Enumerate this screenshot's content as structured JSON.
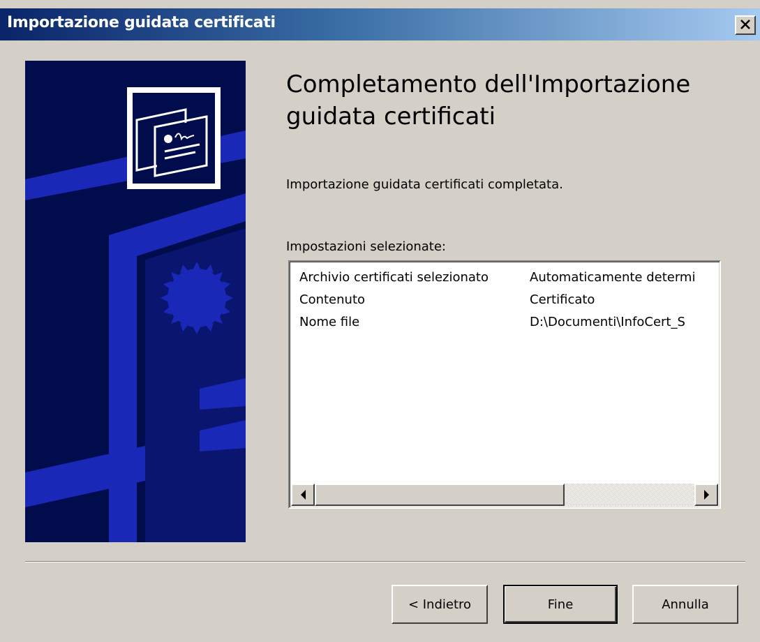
{
  "window": {
    "title": "Importazione guidata certificati"
  },
  "main": {
    "heading": "Completamento dell'Importazione guidata certificati",
    "completed_message": "Importazione guidata certificati completata.",
    "settings_label": "Impostazioni selezionate:",
    "settings": [
      {
        "name": "Archivio certificati selezionato",
        "value": "Automaticamente determi"
      },
      {
        "name": "Contenuto",
        "value": "Certificato"
      },
      {
        "name": "Nome file",
        "value": "D:\\Documenti\\InfoCert_S"
      }
    ]
  },
  "buttons": {
    "back": "< Indietro",
    "finish": "Fine",
    "cancel": "Annulla"
  },
  "icons": {
    "close": "close-icon",
    "wizard_graphic": "certificate-icon",
    "scroll_left": "scroll-left-arrow-icon",
    "scroll_right": "scroll-right-arrow-icon"
  },
  "colors": {
    "titlebar_start": "#0a246a",
    "titlebar_end": "#a6caf0",
    "side_panel": "#000c4c",
    "dialog_face": "#d4d0c8"
  }
}
